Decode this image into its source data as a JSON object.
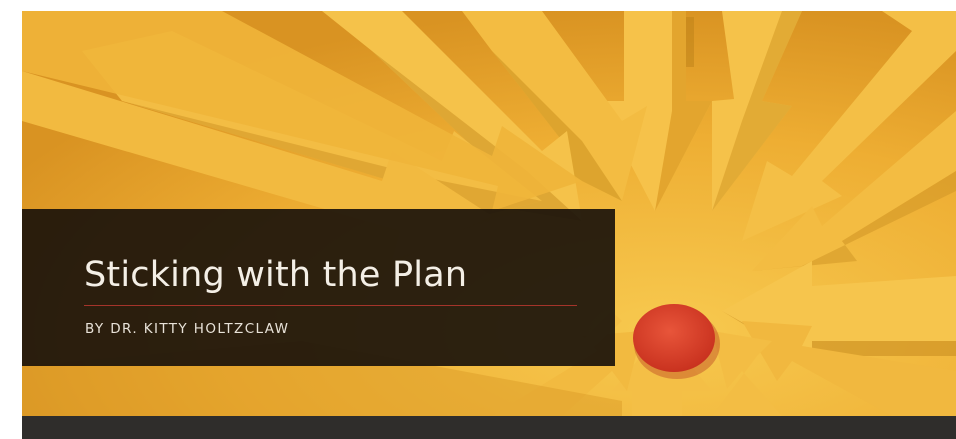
{
  "hero": {
    "title": "Sticking with the Plan",
    "byline": "BY DR. KITTY HOLTZCLAW"
  },
  "colors": {
    "background_yellow": "#e8a82e",
    "arrow_light": "#f6c24a",
    "arrow_shadow": "#b97f16",
    "target_red": "#d8402a",
    "title_card": "#16100a",
    "rule_red": "#a5342a",
    "bottom_bar": "#2f2d2b"
  },
  "icons": {
    "target": "red-dot-target-icon",
    "arrows": "converging-arrows-illustration"
  }
}
